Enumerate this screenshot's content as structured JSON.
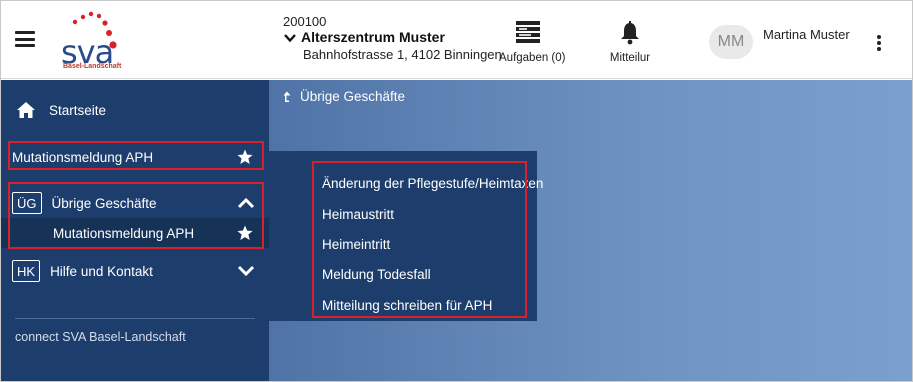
{
  "header": {
    "org_id": "200100",
    "org_name": "Alterszentrum Muster",
    "org_address": "Bahnhofstrasse 1, 4102 Binningen",
    "tasks_label": "Aufgaben (0)",
    "notifications_label": "Mitteilur",
    "avatar_initials": "MM",
    "user_name": "Martina Muster"
  },
  "logo": {
    "text": "sva",
    "subtext": "Basel-Landschaft"
  },
  "sidebar": {
    "home_label": "Startseite",
    "favorite_label": "Mutationsmeldung APH",
    "ug_badge": "ÜG",
    "ug_label": "Übrige Geschäfte",
    "ug_sub_label": "Mutationsmeldung APH",
    "hk_badge": "HK",
    "hk_label": "Hilfe und Kontakt",
    "footer": "connect SVA Basel-Landschaft"
  },
  "main": {
    "breadcrumb": "Übrige Geschäfte",
    "menu_items": [
      "Änderung der Pflegestufe/Heimtaxen",
      "Heimaustritt",
      "Heimeintritt",
      "Meldung Todesfall",
      "Mitteilung schreiben für APH"
    ]
  },
  "colors": {
    "sidebar_bg": "#1d3e6c",
    "highlight_red": "#d9212a",
    "main_gradient_start": "#4f73a6",
    "main_gradient_end": "#7aa0cf"
  },
  "icons": [
    "hamburger-icon",
    "chevron-down-icon",
    "tasks-icon",
    "bell-icon",
    "kebab-menu-icon",
    "home-icon",
    "star-icon",
    "chevron-up-icon",
    "arrow-up-icon"
  ]
}
